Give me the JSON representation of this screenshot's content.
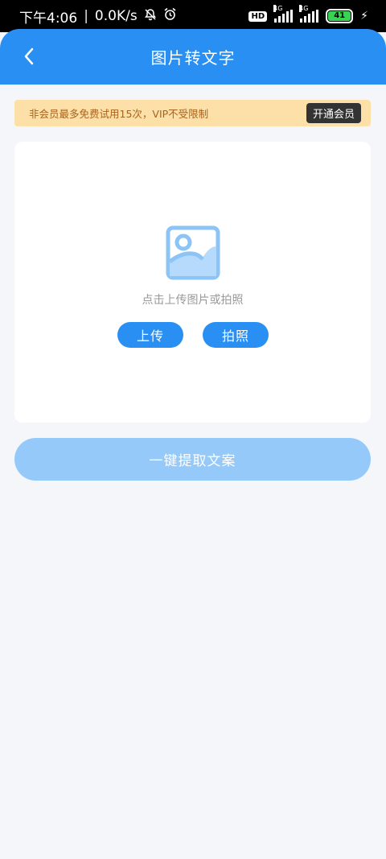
{
  "status_bar": {
    "time": "下午4:06",
    "separator": "|",
    "net_speed": "0.0K/s",
    "hd_label": "HD",
    "signal1_label": "4G",
    "signal2_label": "4G",
    "battery": "41"
  },
  "header": {
    "title": "图片转文字"
  },
  "vip_banner": {
    "text": "非会员最多免费试用15次，VIP不受限制",
    "button_label": "开通会员"
  },
  "upload": {
    "hint": "点击上传图片或拍照",
    "upload_label": "上传",
    "camera_label": "拍照"
  },
  "extract": {
    "label": "一键提取文案"
  },
  "colors": {
    "primary": "#2a8ff3",
    "disabled_primary": "#94c9fa",
    "banner_bg": "#fde0a8",
    "banner_text": "#a8621b"
  }
}
